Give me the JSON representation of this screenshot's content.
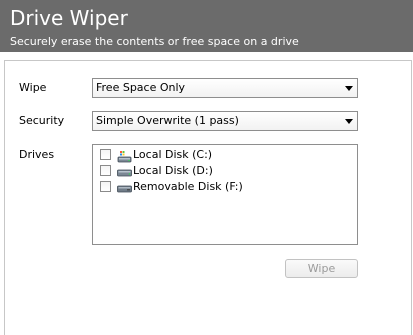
{
  "header": {
    "title": "Drive Wiper",
    "subtitle": "Securely erase the contents or free space on a drive",
    "background_color": "#6b6b6b"
  },
  "form": {
    "wipe": {
      "label": "Wipe",
      "selected": "Free Space Only"
    },
    "security": {
      "label": "Security",
      "selected": "Simple Overwrite (1 pass)"
    },
    "drives": {
      "label": "Drives",
      "items": [
        {
          "label": "Local Disk (C:)",
          "checked": false,
          "icon": "system-drive-icon"
        },
        {
          "label": "Local Disk (D:)",
          "checked": false,
          "icon": "hard-drive-icon"
        },
        {
          "label": "Removable Disk (F:)",
          "checked": false,
          "icon": "removable-drive-icon"
        }
      ]
    }
  },
  "actions": {
    "wipe_label": "Wipe",
    "wipe_enabled": false
  }
}
